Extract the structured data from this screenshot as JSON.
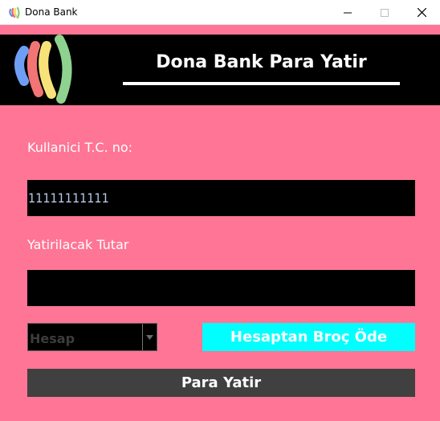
{
  "window": {
    "title": "Dona Bank",
    "app_icon": "dona-bank-logo-icon",
    "controls": {
      "minimize": "minimize-icon",
      "maximize": "maximize-icon",
      "close": "close-icon"
    }
  },
  "header": {
    "title": "Dona Bank Para Yatir",
    "logo": "dona-bank-logo-icon",
    "background": "#000000"
  },
  "form": {
    "tc_label": "Kullanici T.C. no:",
    "tc_value": "11111111111",
    "amount_label": "Yatirilacak Tutar",
    "amount_value": "",
    "account_select": {
      "selected": "Hesap"
    },
    "pay_debt_button": "Hesaptan Broç Öde",
    "deposit_button": "Para Yatir"
  },
  "colors": {
    "background": "#ff7596",
    "accent_button": "#00ffff",
    "primary_button": "#404040"
  }
}
